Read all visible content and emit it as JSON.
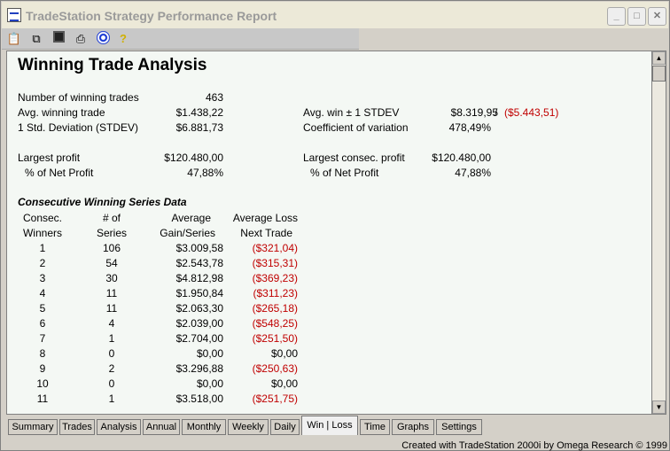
{
  "window": {
    "title": "TradeStation Strategy Performance Report",
    "min_icon": "minimize-icon",
    "max_icon": "maximize-icon",
    "close_icon": "close-icon"
  },
  "toolbar": {
    "icons": [
      "properties-icon",
      "copy-icon",
      "save-icon",
      "print-icon",
      "target-icon",
      "help-icon"
    ]
  },
  "report": {
    "heading": "Winning Trade Analysis",
    "left_stats": [
      {
        "label": "Number of winning trades",
        "value": "463"
      },
      {
        "label": "Avg. winning trade",
        "value": "$1.438,22"
      },
      {
        "label": "1 Std. Deviation (STDEV)",
        "value": "$6.881,73"
      }
    ],
    "avg_win_label": "Avg. win ± 1 STDEV",
    "avg_win_plus": "$8.319,95",
    "avg_win_sep": "/",
    "avg_win_minus": "($5.443,51)",
    "coef_label": "Coefficient of variation",
    "coef_value": "478,49%",
    "largest_profit_label": "Largest profit",
    "largest_profit_value": "$120.480,00",
    "pct_net_label": "% of Net Profit",
    "pct_net_value": "47,88%",
    "largest_consec_label": "Largest consec. profit",
    "largest_consec_value": "$120.480,00",
    "pct_net_label2": "% of Net Profit",
    "pct_net_value2": "47,88%",
    "series_title": "Consecutive Winning Series Data",
    "columns": {
      "c1a": "Consec.",
      "c1b": "Winners",
      "c2a": "# of",
      "c2b": "Series",
      "c3a": "Average",
      "c3b": "Gain/Series",
      "c4a": "Average Loss",
      "c4b": "Next Trade"
    },
    "rows": [
      {
        "winners": "1",
        "series": "106",
        "gain": "$3.009,58",
        "loss": "($321,04)",
        "loss_red": true
      },
      {
        "winners": "2",
        "series": "54",
        "gain": "$2.543,78",
        "loss": "($315,31)",
        "loss_red": true
      },
      {
        "winners": "3",
        "series": "30",
        "gain": "$4.812,98",
        "loss": "($369,23)",
        "loss_red": true
      },
      {
        "winners": "4",
        "series": "11",
        "gain": "$1.950,84",
        "loss": "($311,23)",
        "loss_red": true
      },
      {
        "winners": "5",
        "series": "11",
        "gain": "$2.063,30",
        "loss": "($265,18)",
        "loss_red": true
      },
      {
        "winners": "6",
        "series": "4",
        "gain": "$2.039,00",
        "loss": "($548,25)",
        "loss_red": true
      },
      {
        "winners": "7",
        "series": "1",
        "gain": "$2.704,00",
        "loss": "($251,50)",
        "loss_red": true
      },
      {
        "winners": "8",
        "series": "0",
        "gain": "$0,00",
        "loss": "$0,00",
        "loss_red": false
      },
      {
        "winners": "9",
        "series": "2",
        "gain": "$3.296,88",
        "loss": "($250,63)",
        "loss_red": true
      },
      {
        "winners": "10",
        "series": "0",
        "gain": "$0,00",
        "loss": "$0,00",
        "loss_red": false
      },
      {
        "winners": "11",
        "series": "1",
        "gain": "$3.518,00",
        "loss": "($251,75)",
        "loss_red": true
      }
    ],
    "loss_color": "#c00000"
  },
  "tabs": [
    {
      "label": "Summary",
      "active": false
    },
    {
      "label": "Trades",
      "active": false
    },
    {
      "label": "Analysis",
      "active": false
    },
    {
      "label": "Annual",
      "active": false
    },
    {
      "label": "Monthly",
      "active": false
    },
    {
      "label": "Weekly",
      "active": false
    },
    {
      "label": "Daily",
      "active": false
    },
    {
      "label": "Win | Loss",
      "active": true
    },
    {
      "label": "Time",
      "active": false
    },
    {
      "label": "Graphs",
      "active": false
    },
    {
      "label": "Settings",
      "active": false
    }
  ],
  "footer": "Created with TradeStation 2000i by Omega Research © 1999"
}
